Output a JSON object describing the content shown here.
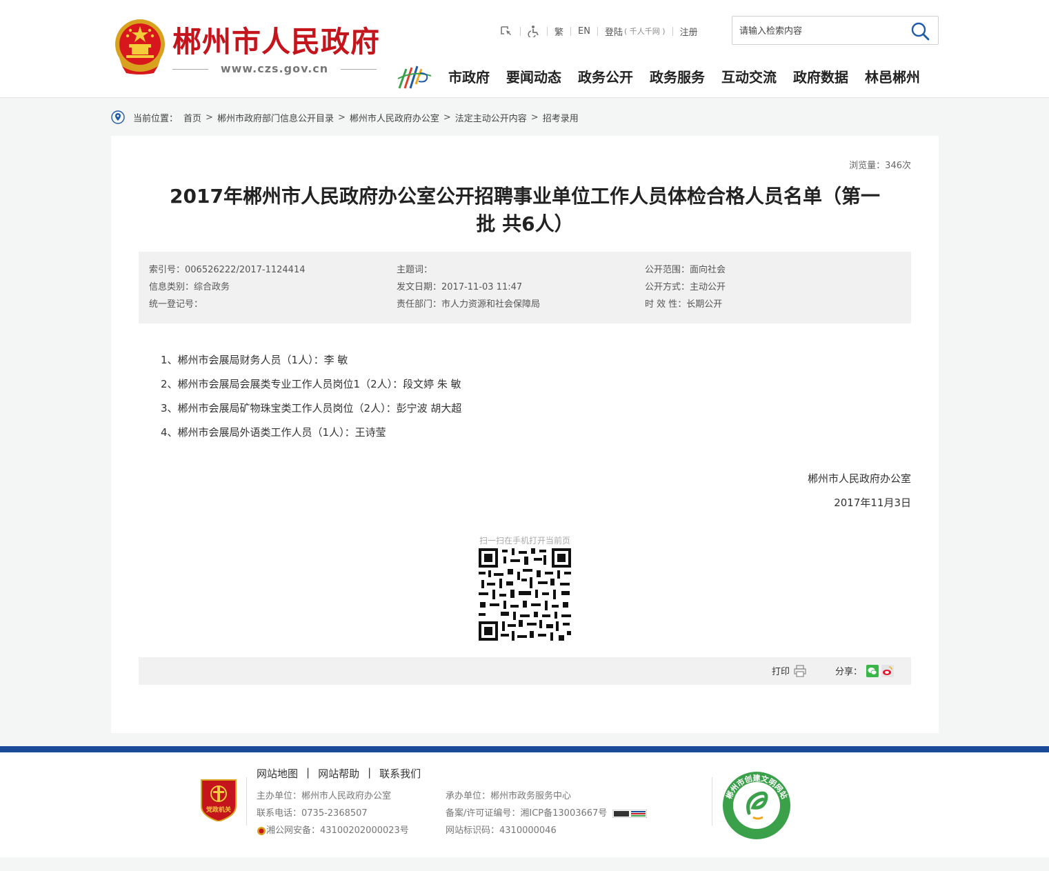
{
  "header": {
    "site_name": "郴州市人民政府",
    "site_url": "www.czs.gov.cn",
    "toplinks": {
      "traditional": "繁",
      "english": "EN",
      "login": "登陆",
      "login_sub": "( 千人千网 )",
      "register": "注册"
    },
    "search_placeholder": "请输入检索内容",
    "nav": [
      "市政府",
      "要闻动态",
      "政务公开",
      "政务服务",
      "互动交流",
      "政府数据",
      "林邑郴州"
    ]
  },
  "breadcrumb": {
    "label": "当前位置：",
    "items": [
      "首页",
      "郴州市政府部门信息公开目录",
      "郴州市人民政府办公室",
      "法定主动公开内容",
      "招考录用"
    ],
    "separator": ">"
  },
  "article": {
    "views": "浏览量：346次",
    "title_line1": "2017年郴州市人民政府办公室公开招聘事业单位工作人员体检合格人员名单（第一",
    "title_line2": "批 共6人）",
    "meta": {
      "index_no": "索引号：006526222/2017-1124414",
      "category": "信息类别：综合政务",
      "reg_no": "统一登记号：",
      "subject": "主题词：",
      "publish_date": "发文日期：2017-11-03 11:47",
      "department": "责任部门：市人力资源和社会保障局",
      "scope": "公开范围：面向社会",
      "method": "公开方式：主动公开",
      "validity": "时 效 性：长期公开"
    },
    "items": [
      "1、郴州市会展局财务人员（1人）：李  敏",
      "2、郴州市会展局会展类专业工作人员岗位1（2人）：段文婷  朱  敏",
      "3、郴州市会展局矿物珠宝类工作人员岗位（2人）：彭宁波  胡大超",
      "4、郴州市会展局外语类工作人员（1人）：王诗莹"
    ],
    "signer": "郴州市人民政府办公室",
    "sign_date": "2017年11月3日",
    "qr_caption": "扫一扫在手机打开当前页",
    "print_label": "打印",
    "share_label": "分享："
  },
  "footer": {
    "links": [
      "网站地图",
      "网站帮助",
      "联系我们"
    ],
    "link_sep": "|",
    "host": "主办单位：郴州市人民政府办公室",
    "phone": "联系电话：0735-2368507",
    "police": "湘公网安备：43100202000023号",
    "undertaker": "承办单位：郴州市政务服务中心",
    "icp": "备案/许可证编号：湘ICP备13003667号",
    "site_code": "网站标识码：4310000046",
    "party_badge_text": "党政机关",
    "civil_badge_text": "郴州市创建文明网站"
  },
  "colors": {
    "brand_red": "#c4151c",
    "footer_blue": "#1a4a98",
    "icon_blue": "#1f5aa6"
  }
}
